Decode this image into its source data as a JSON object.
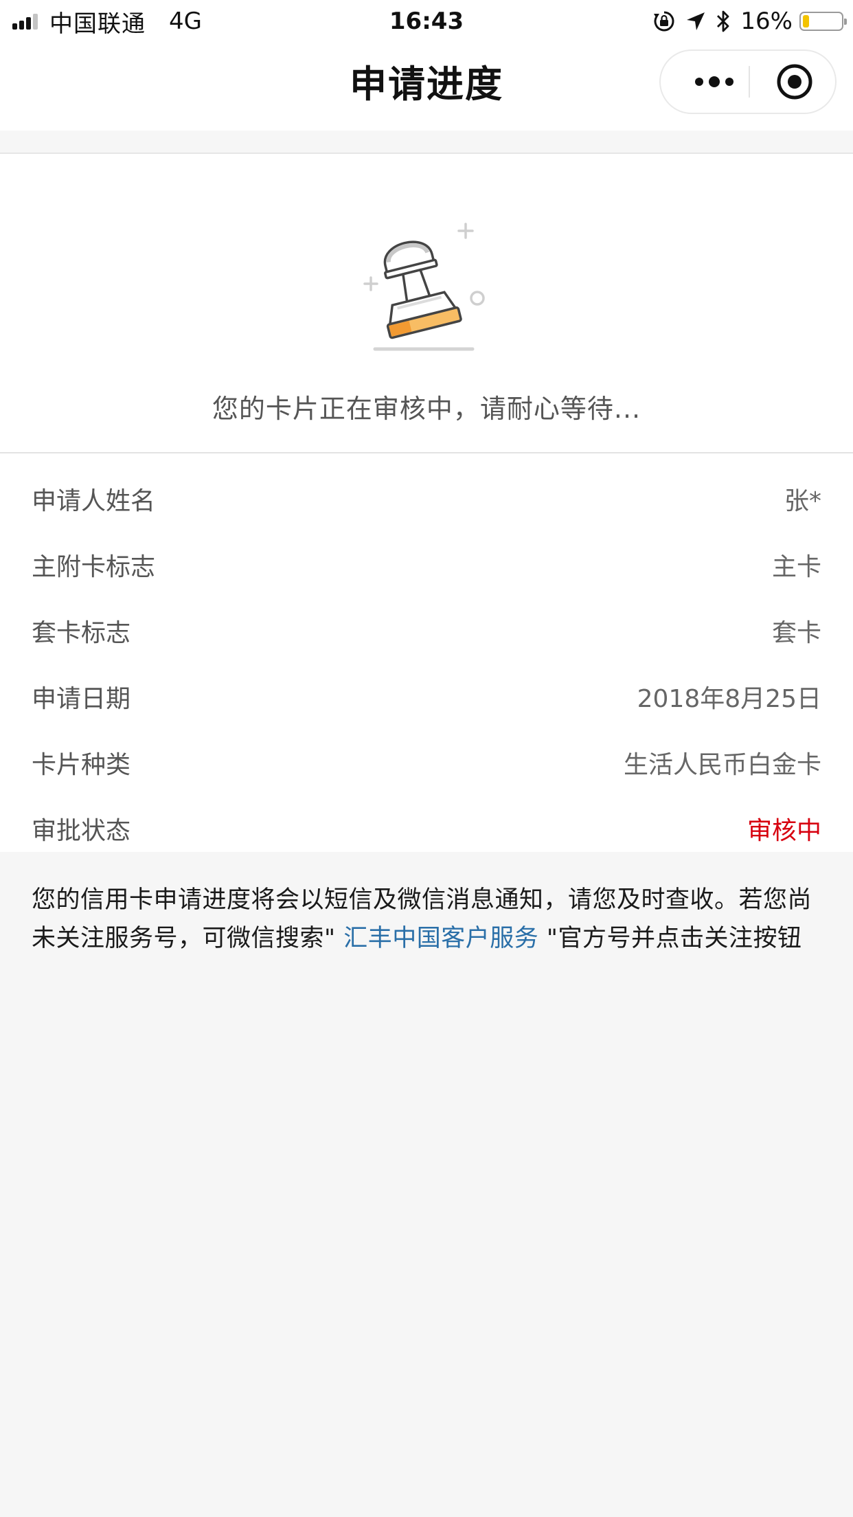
{
  "status_bar": {
    "carrier": "中国联通",
    "network": "4G",
    "time": "16:43",
    "battery_percent": "16%",
    "battery_level": 0.16,
    "icons": [
      "rotation-lock-icon",
      "location-arrow-icon",
      "bluetooth-icon"
    ]
  },
  "nav": {
    "title": "申请进度",
    "more_icon": "more-dots-icon",
    "close_icon": "target-close-icon"
  },
  "hero": {
    "illustration": "stamp-icon",
    "message": "您的卡片正在审核中，请耐心等待..."
  },
  "info": {
    "rows": [
      {
        "label": "申请人姓名",
        "value": "张*"
      },
      {
        "label": "主附卡标志",
        "value": "主卡"
      },
      {
        "label": "套卡标志",
        "value": "套卡"
      },
      {
        "label": "申请日期",
        "value": "2018年8月25日"
      },
      {
        "label": "卡片种类",
        "value": "生活人民币白金卡"
      },
      {
        "label": "审批状态",
        "value": "审核中"
      }
    ],
    "status_color": "#d7000f"
  },
  "notice": {
    "text_before": "您的信用卡申请进度将会以短信及微信消息通知，请您及时查收。若您尚未关注服务号，可微信搜索\"",
    "link_text": " 汇丰中国客户服务 ",
    "text_after": "\"官方号并点击关注按钮",
    "link_color": "#2a6fa8"
  }
}
